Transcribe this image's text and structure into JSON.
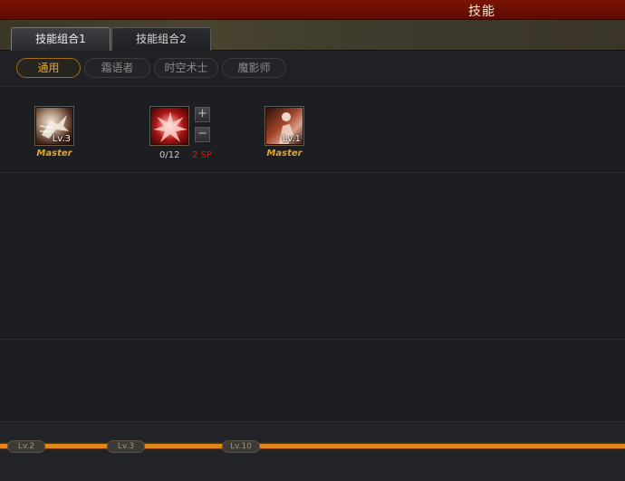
{
  "window": {
    "title": "技能"
  },
  "tabs": [
    {
      "label": "技能组合1",
      "active": true
    },
    {
      "label": "技能组合2",
      "active": false
    }
  ],
  "filters": [
    {
      "label": "通用",
      "active": true
    },
    {
      "label": "霜语者",
      "active": false
    },
    {
      "label": "时空术士",
      "active": false
    },
    {
      "label": "魔影师",
      "active": false
    }
  ],
  "skills": [
    {
      "icon": "runner-skill-icon",
      "level_text": "Lv.3",
      "status": "Master"
    },
    {
      "icon": "burst-skill-icon",
      "points": "0/12",
      "sp_cost": "2 SP",
      "plus": "+",
      "minus": "−"
    },
    {
      "icon": "figure-skill-icon",
      "level_text": "Lv.1",
      "status": "Master"
    }
  ],
  "level_markers": [
    "Lv.2",
    "Lv.3",
    "Lv.10"
  ],
  "colors": {
    "title_bar": "#6b1004",
    "accent_orange": "#e2861a",
    "master_gold": "#e0a626",
    "sp_red": "#d81a12"
  }
}
